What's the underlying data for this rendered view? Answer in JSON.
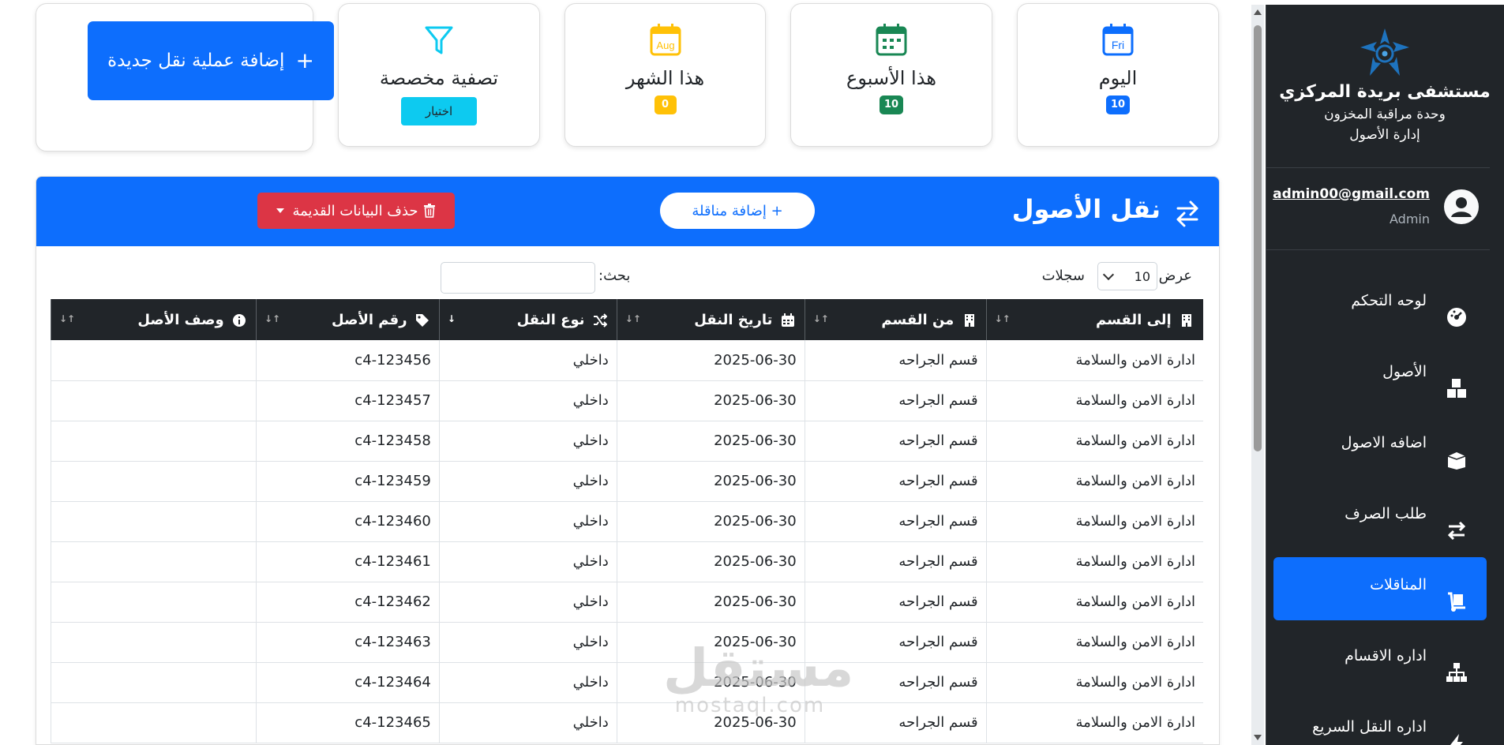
{
  "brand": {
    "name": "مستشفى بريدة المركزي",
    "sub1": "وحدة مراقبة المخزون",
    "sub2": "إدارة الأصول"
  },
  "user": {
    "email": "admin00@gmail.com",
    "role": "Admin"
  },
  "nav": [
    {
      "label": "لوحه التحكم",
      "icon": "dashboard-icon",
      "active": false
    },
    {
      "label": "الأصول",
      "icon": "boxes-icon",
      "active": false
    },
    {
      "label": "اضافه الاصول",
      "icon": "box-open-icon",
      "active": false
    },
    {
      "label": "طلب الصرف",
      "icon": "exchange-icon",
      "active": false
    },
    {
      "label": "المناقلات",
      "icon": "dolly-icon",
      "active": true
    },
    {
      "label": "اداره الاقسام",
      "icon": "sitemap-icon",
      "active": false
    },
    {
      "label": "اداره النقل السريع",
      "icon": "bolt-icon",
      "active": false
    }
  ],
  "stats": {
    "today": {
      "title": "اليوم",
      "count": "10",
      "icon_text": "Fri",
      "color": "#0d6efd"
    },
    "week": {
      "title": "هذا الأسبوع",
      "count": "10",
      "color": "#198754"
    },
    "month": {
      "title": "هذا الشهر",
      "count": "0",
      "icon_text": "Aug",
      "color": "#ffc107"
    },
    "filter": {
      "title": "تصفية مخصصة",
      "button": "اختيار",
      "color": "#0dcaf0"
    }
  },
  "add_transfer": {
    "plus": "+",
    "label": "إضافة عملية نقل جديدة"
  },
  "panel": {
    "title": "نقل الأصول",
    "add_contractor": "+ إضافة مناقلة",
    "delete_old": "حذف البيانات القديمة"
  },
  "controls": {
    "show_label": "عرض",
    "page_length": "10",
    "records_label": "سجلات",
    "search_label": "بحث:"
  },
  "table": {
    "columns": [
      "إلى القسم",
      "من القسم",
      "تاريخ النقل",
      "نوع النقل",
      "رقم الأصل",
      "وصف الأصل"
    ],
    "rows": [
      [
        "ادارة الامن والسلامة",
        "قسم الجراحه",
        "2025-06-30",
        "داخلي",
        "c4-123456",
        ""
      ],
      [
        "ادارة الامن والسلامة",
        "قسم الجراحه",
        "2025-06-30",
        "داخلي",
        "c4-123457",
        ""
      ],
      [
        "ادارة الامن والسلامة",
        "قسم الجراحه",
        "2025-06-30",
        "داخلي",
        "c4-123458",
        ""
      ],
      [
        "ادارة الامن والسلامة",
        "قسم الجراحه",
        "2025-06-30",
        "داخلي",
        "c4-123459",
        ""
      ],
      [
        "ادارة الامن والسلامة",
        "قسم الجراحه",
        "2025-06-30",
        "داخلي",
        "c4-123460",
        ""
      ],
      [
        "ادارة الامن والسلامة",
        "قسم الجراحه",
        "2025-06-30",
        "داخلي",
        "c4-123461",
        ""
      ],
      [
        "ادارة الامن والسلامة",
        "قسم الجراحه",
        "2025-06-30",
        "داخلي",
        "c4-123462",
        ""
      ],
      [
        "ادارة الامن والسلامة",
        "قسم الجراحه",
        "2025-06-30",
        "داخلي",
        "c4-123463",
        ""
      ],
      [
        "ادارة الامن والسلامة",
        "قسم الجراحه",
        "2025-06-30",
        "داخلي",
        "c4-123464",
        ""
      ],
      [
        "ادارة الامن والسلامة",
        "قسم الجراحه",
        "2025-06-30",
        "داخلي",
        "c4-123465",
        ""
      ]
    ]
  },
  "watermark": {
    "arabic": "مستقل",
    "latin": "mostaql.com"
  }
}
